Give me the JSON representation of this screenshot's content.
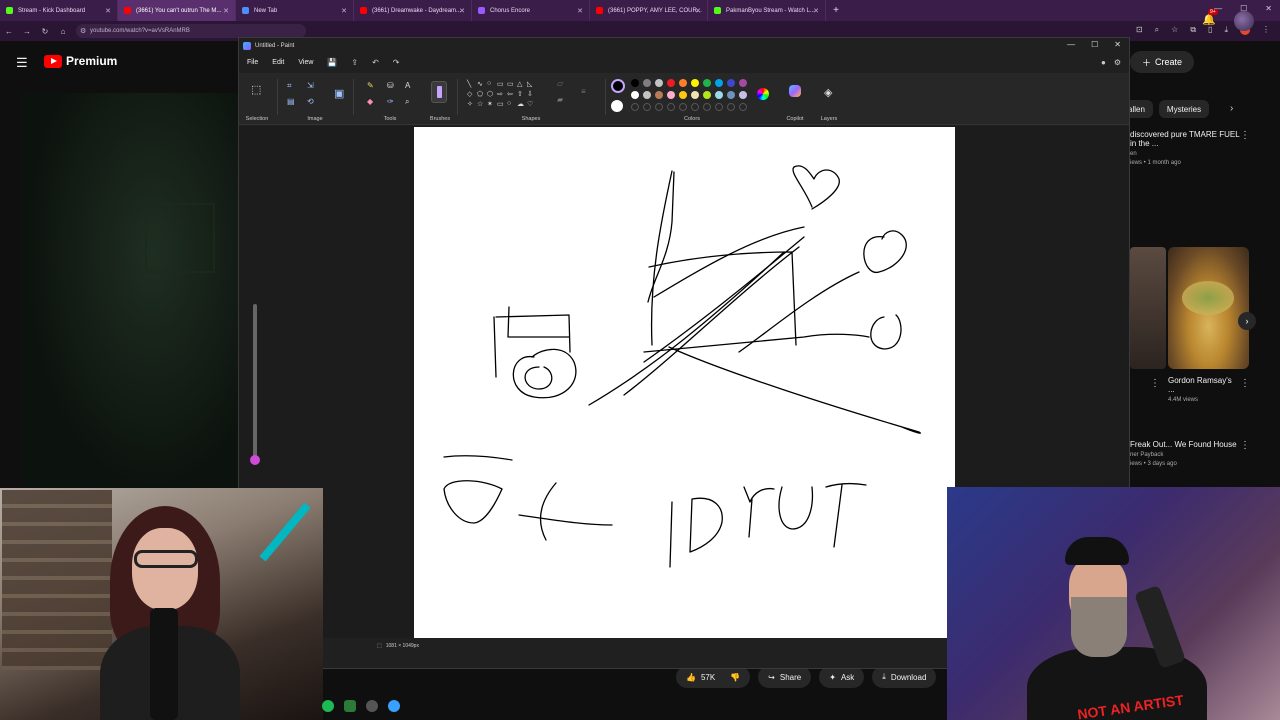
{
  "browser": {
    "tabs": [
      {
        "label": "Stream - Kick Dashboard",
        "color": "#53fc18",
        "active": false
      },
      {
        "label": "(3661) You can't outrun The M...",
        "color": "#ff0000",
        "active": true
      },
      {
        "label": "New Tab",
        "color": "#4d8eff",
        "active": false
      },
      {
        "label": "(3661) Dreamwake - Daydream...",
        "color": "#ff0000",
        "active": false
      },
      {
        "label": "Chorus Encore",
        "color": "#9b59ff",
        "active": false
      },
      {
        "label": "(3661) POPPY, AMY LEE, COUR...",
        "color": "#ff0000",
        "active": false
      },
      {
        "label": "PakmanByou Stream - Watch L...",
        "color": "#53fc18",
        "active": false
      }
    ],
    "new_tab_glyph": "+",
    "address": "youtube.com/watch?v=avVsRAnMRB"
  },
  "youtube": {
    "logo_text": "Premium",
    "create_label": "Create",
    "notif_badge": "9+",
    "chips": [
      "allen",
      "Mysteries"
    ],
    "recommendations": [
      {
        "title": "discovered pure TMARE FUEL in the ...",
        "channel": "en",
        "meta": "iews • 1 month ago"
      },
      {
        "title": "Gordon Ramsay's ...",
        "channel": "",
        "meta": "4.4M views"
      },
      {
        "title": "Freak Out... We Found House",
        "channel": "ner Payback",
        "meta": "iews • 3 days ago"
      }
    ],
    "actions": {
      "like_count": "57K",
      "share": "Share",
      "ask": "Ask",
      "download": "Download"
    }
  },
  "paint": {
    "title": "Untitled - Paint",
    "menu": [
      "File",
      "Edit",
      "View"
    ],
    "groups": [
      "Selection",
      "Image",
      "Tools",
      "Brushes",
      "Shapes",
      "Colors",
      "Copilot",
      "Layers"
    ],
    "status_size": "1081 × 1049px",
    "palette": [
      "#000000",
      "#7f7f7f",
      "#c3c3c3",
      "#ed1c24",
      "#ff7f27",
      "#fff200",
      "#22b14c",
      "#00a2e8",
      "#3f48cc",
      "#a349a4",
      "#ffffff",
      "#c3c3c3",
      "#b97a57",
      "#ffaec9",
      "#ffc90e",
      "#efe4b0",
      "#b5e61d",
      "#99d9ea",
      "#7092be",
      "#c8bfe7"
    ]
  },
  "stream": {
    "shirt_text": "NOT AN ARTIST"
  }
}
